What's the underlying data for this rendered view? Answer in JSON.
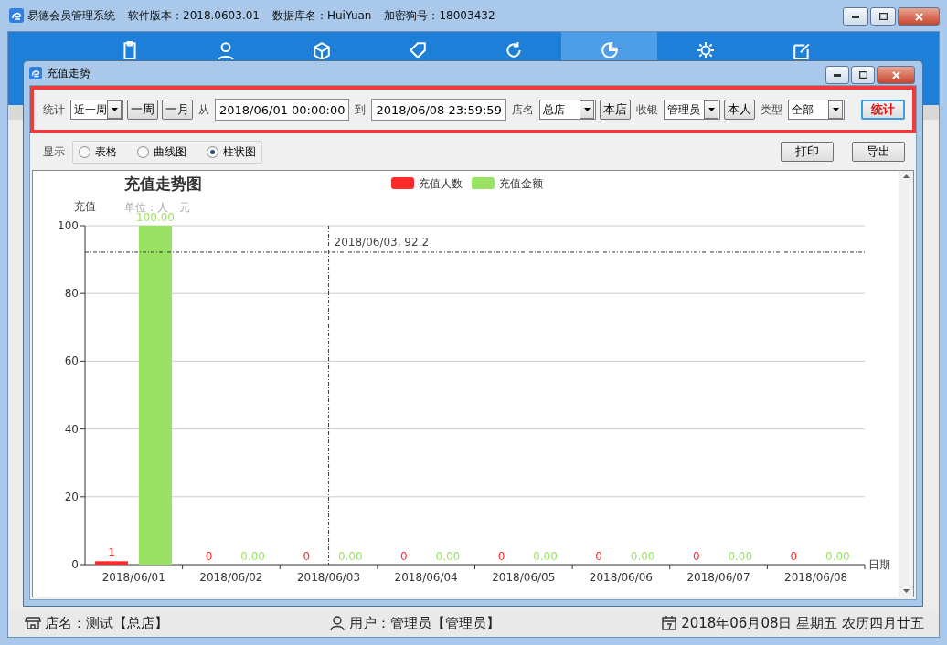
{
  "app": {
    "title": "易德会员管理系统",
    "version": "软件版本：2018.0603.01",
    "database": "数据库名：HuiYuan",
    "dongle": "加密狗号：18003432"
  },
  "nav_tabs": [
    {
      "selected": false
    },
    {
      "selected": false
    },
    {
      "selected": false
    },
    {
      "selected": false
    },
    {
      "selected": false
    },
    {
      "selected": true
    },
    {
      "selected": false
    },
    {
      "selected": false
    }
  ],
  "dialog": {
    "title": "充值走势"
  },
  "filters": [
    {
      "kind": "label",
      "text": "统计"
    },
    {
      "kind": "select",
      "text": "近一周"
    },
    {
      "kind": "button",
      "text": "一周"
    },
    {
      "kind": "button",
      "text": "一月"
    },
    {
      "kind": "label",
      "text": "从"
    },
    {
      "kind": "input",
      "text": "2018/06/01 00:00:00"
    },
    {
      "kind": "label",
      "text": "到"
    },
    {
      "kind": "input",
      "text": "2018/06/08 23:59:59"
    },
    {
      "kind": "label",
      "text": "店名"
    },
    {
      "kind": "select",
      "text": "总店"
    },
    {
      "kind": "button",
      "text": "本店"
    },
    {
      "kind": "label",
      "text": "收银"
    },
    {
      "kind": "select",
      "text": "管理员"
    },
    {
      "kind": "button",
      "text": "本人"
    },
    {
      "kind": "label",
      "text": "类型"
    },
    {
      "kind": "select",
      "text": "全部"
    },
    {
      "kind": "primary",
      "text": "统计"
    }
  ],
  "display": {
    "label": "显示",
    "options": [
      {
        "label": "表格",
        "selected": false
      },
      {
        "label": "曲线图",
        "selected": false
      },
      {
        "label": "柱状图",
        "selected": true
      }
    ]
  },
  "actions": [
    "打印",
    "导出"
  ],
  "chart": {
    "units": "单位：人　元",
    "chart_data": {
      "type": "bar",
      "title": "充值走势图",
      "xlabel": "日期",
      "ylabel": "充值",
      "categories": [
        "2018/06/01",
        "2018/06/02",
        "2018/06/03",
        "2018/06/04",
        "2018/06/05",
        "2018/06/06",
        "2018/06/07",
        "2018/06/08"
      ],
      "series": [
        {
          "name": "充值人数",
          "color": "#ff2a2a",
          "values": [
            1,
            0,
            0,
            0,
            0,
            0,
            0,
            0
          ]
        },
        {
          "name": "充值金额",
          "color": "#99e264",
          "values": [
            100,
            0,
            0,
            0,
            0,
            0,
            0,
            0
          ]
        }
      ],
      "ylim": [
        0,
        100
      ],
      "yticks": [
        0,
        20,
        40,
        60,
        80,
        100
      ],
      "grid": true,
      "legend": "top",
      "ref_lines": [
        {
          "axis": "y",
          "value": 92.2
        },
        {
          "axis": "x",
          "value": "2018/06/03"
        }
      ],
      "value_labels": [
        [
          "1",
          "0",
          "0",
          "0",
          "0",
          "0",
          "0",
          "0"
        ],
        [
          "100.00",
          "0.00",
          "0.00",
          "0.00",
          "0.00",
          "0.00",
          "0.00",
          "0.00"
        ]
      ],
      "annotations": [
        "2018/06/03, 92.2"
      ]
    }
  },
  "status": {
    "store": "店名：测试【总店】",
    "user": "用户：管理员【管理员】",
    "date": "2018年06月08日 星期五 农历四月廿五"
  }
}
